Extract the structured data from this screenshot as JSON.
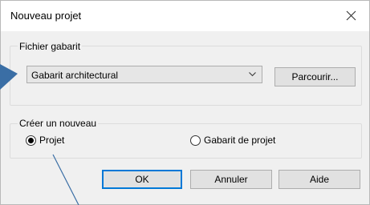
{
  "dialog": {
    "title": "Nouveau projet",
    "close_icon": "close-icon"
  },
  "template_group": {
    "legend": "Fichier gabarit",
    "combo_value": "Gabarit architectural",
    "browse_label": "Parcourir..."
  },
  "create_group": {
    "legend": "Créer un nouveau",
    "options": [
      {
        "label": "Projet",
        "checked": true
      },
      {
        "label": "Gabarit de projet",
        "checked": false
      }
    ]
  },
  "buttons": {
    "ok": "OK",
    "cancel": "Annuler",
    "help": "Aide"
  },
  "colors": {
    "callout": "#3a6ea5",
    "focus": "#0078d7"
  }
}
